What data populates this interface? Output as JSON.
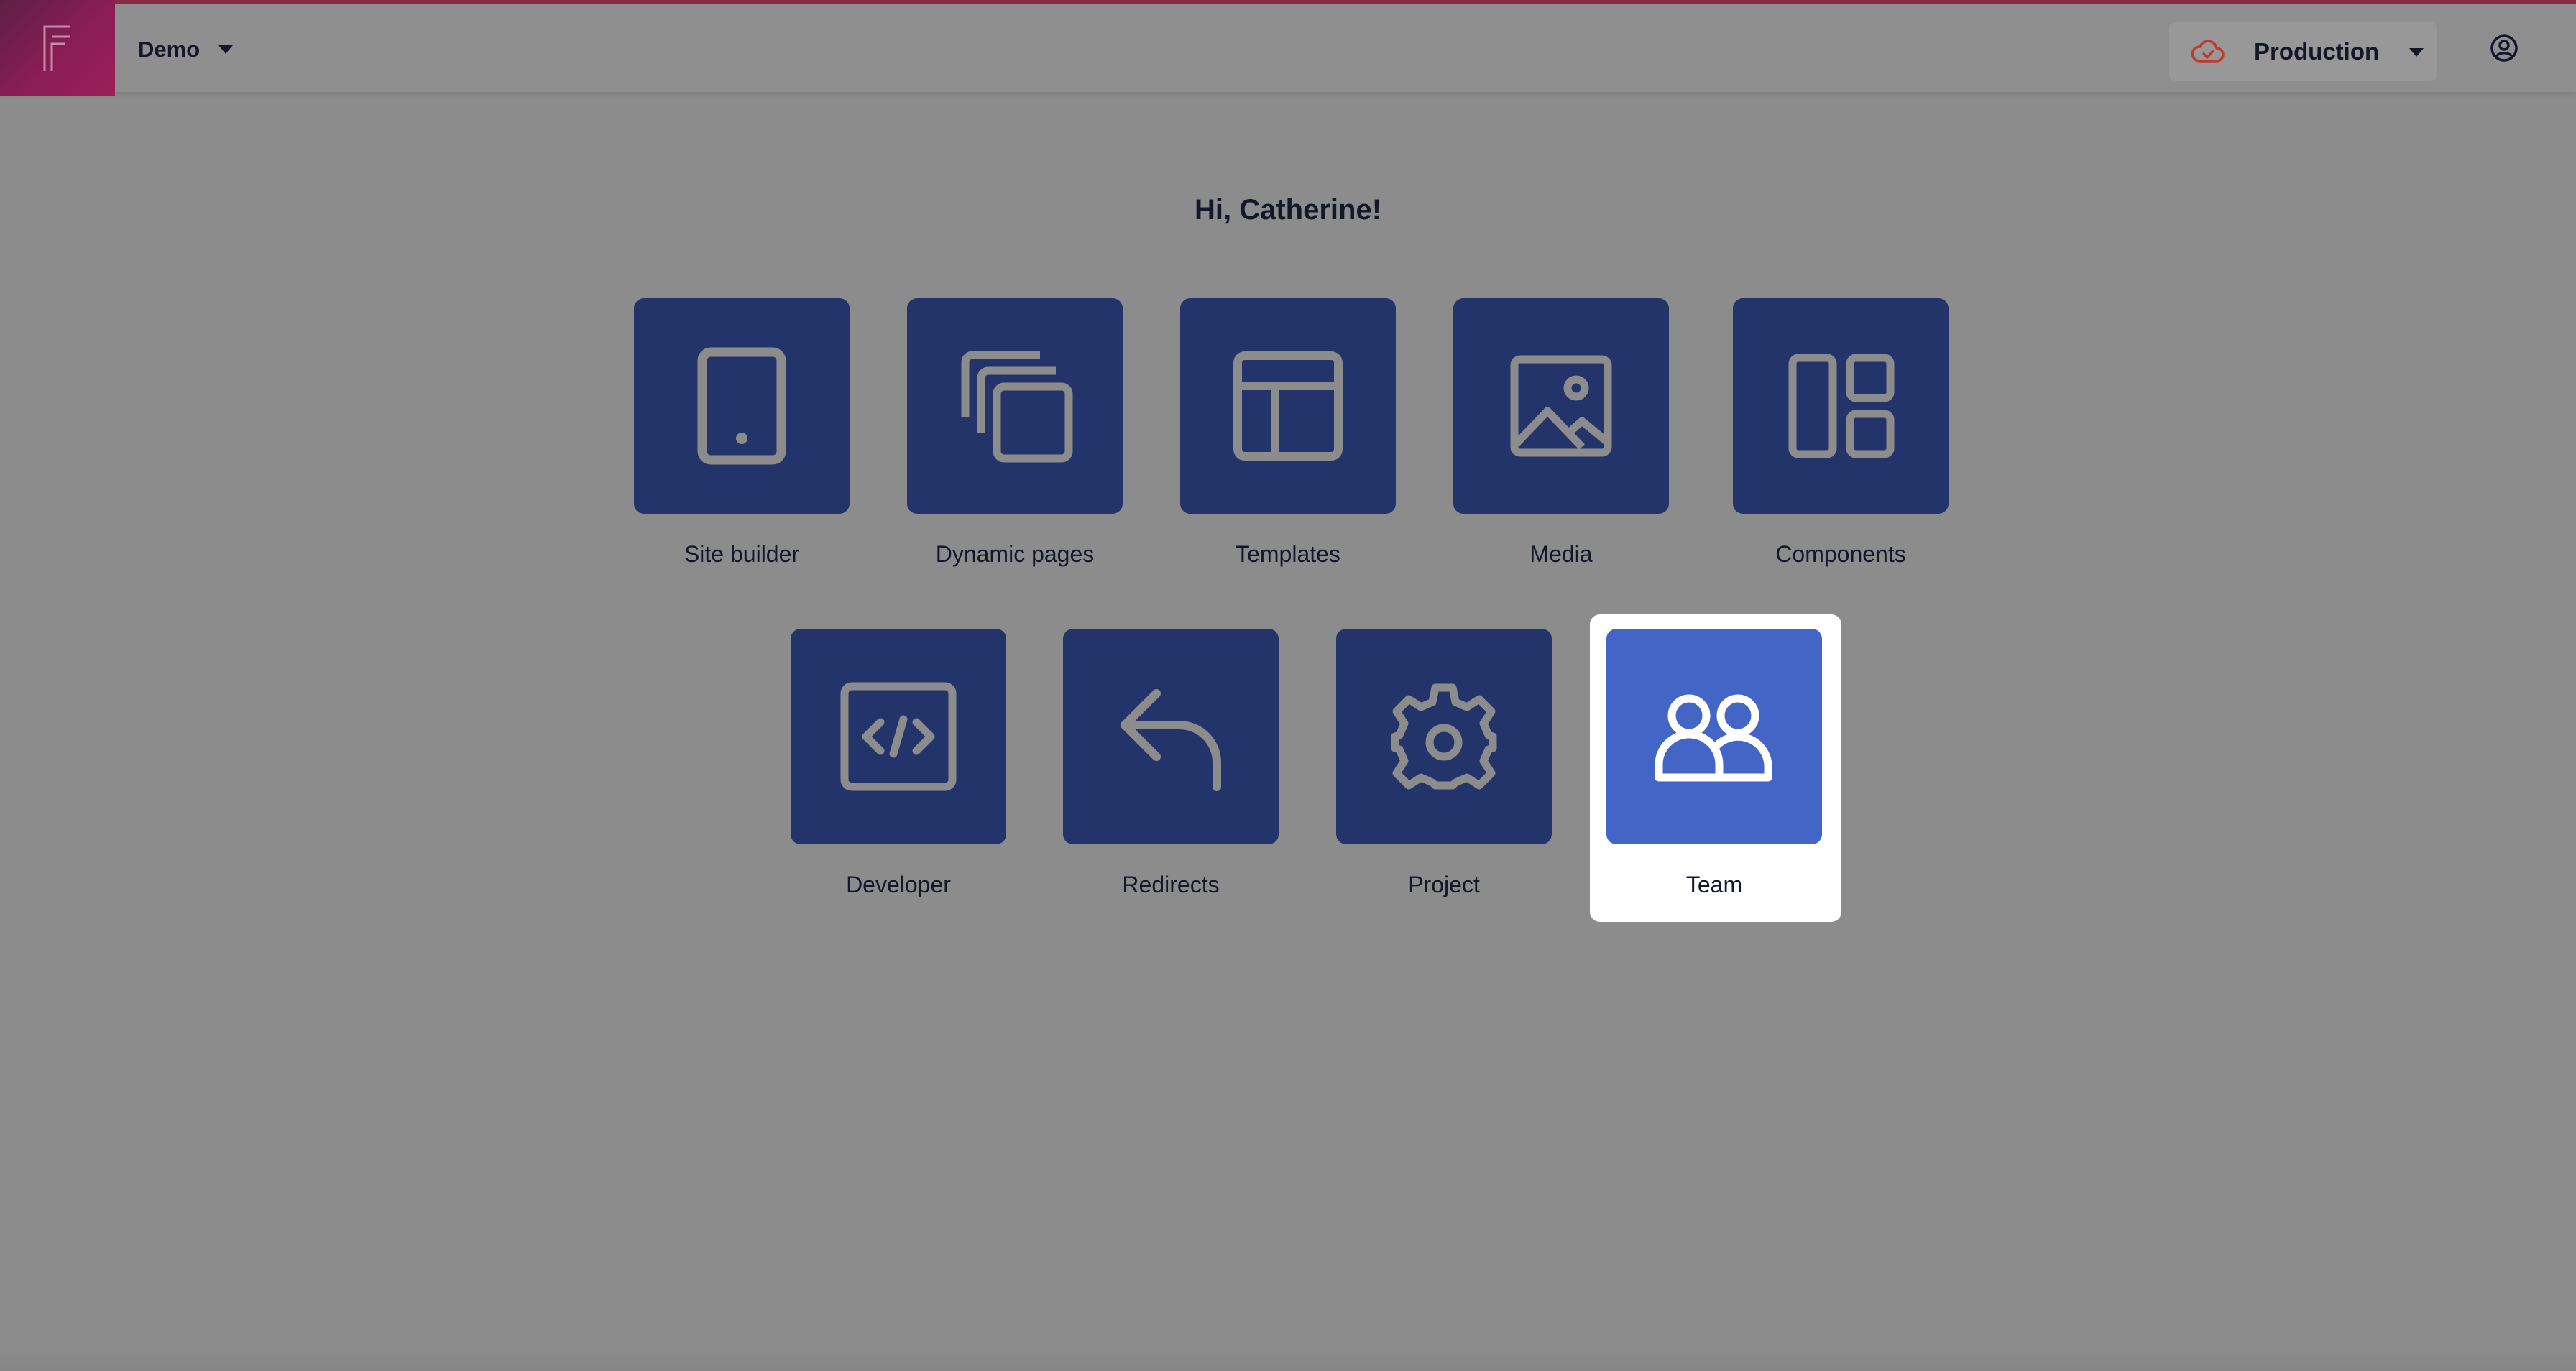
{
  "header": {
    "project_name": "Demo",
    "environment": "Production",
    "env_status_color": "#c0392b"
  },
  "greeting": "Hi, Catherine!",
  "tiles": [
    {
      "label": "Site builder",
      "icon": "mobile-device-icon"
    },
    {
      "label": "Dynamic pages",
      "icon": "stacked-pages-icon"
    },
    {
      "label": "Templates",
      "icon": "layout-template-icon"
    },
    {
      "label": "Media",
      "icon": "image-icon"
    },
    {
      "label": "Components",
      "icon": "components-grid-icon"
    },
    {
      "label": "Developer",
      "icon": "code-icon"
    },
    {
      "label": "Redirects",
      "icon": "redirect-arrow-icon"
    },
    {
      "label": "Project",
      "icon": "gear-icon"
    },
    {
      "label": "Team",
      "icon": "team-users-icon"
    }
  ],
  "active_tile": "Team",
  "colors": {
    "tile": "#23346b",
    "tile_active": "#4365c5",
    "icon_stroke": "#8c8c8c",
    "brand": "#8a1d55"
  }
}
